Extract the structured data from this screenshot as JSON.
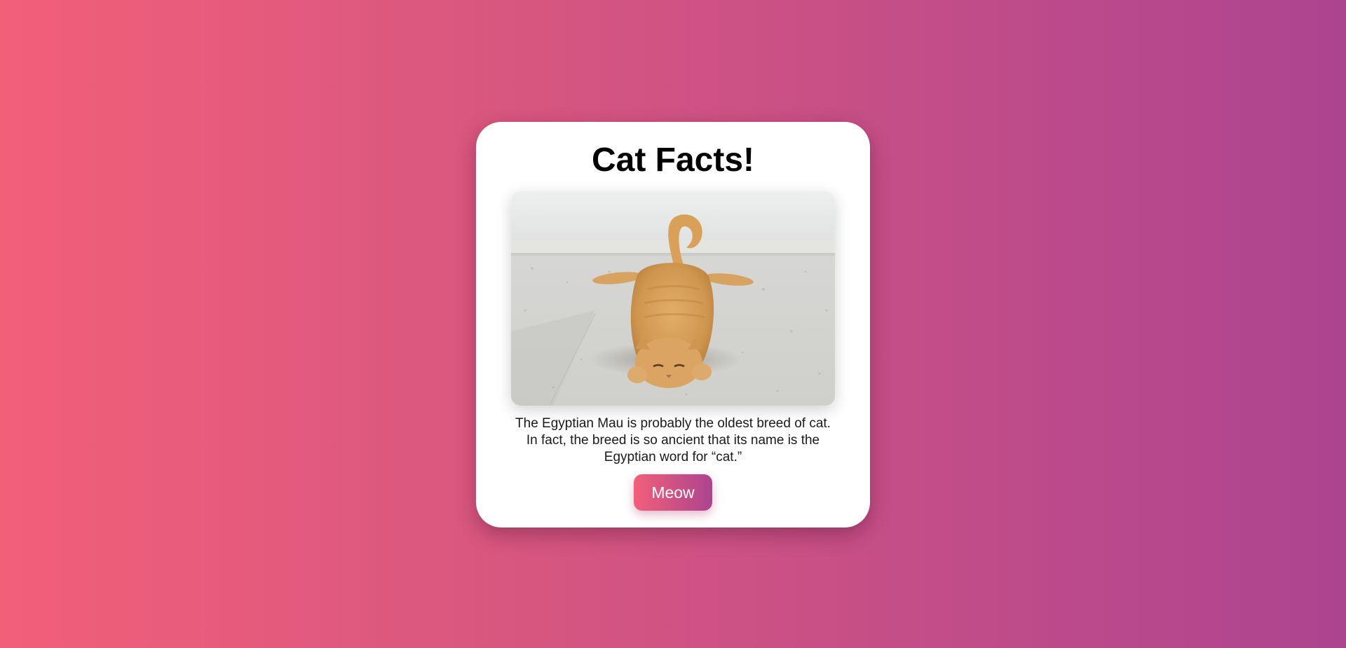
{
  "card": {
    "title": "Cat Facts!",
    "fact": "The Egyptian Mau is probably the oldest breed of cat. In fact, the breed is so ancient that its name is the Egyptian word for “cat.”",
    "button_label": "Meow"
  },
  "colors": {
    "background_start": "#f25f79",
    "background_end": "#ad4490",
    "card": "#ffffff",
    "button_start": "#f25f79",
    "button_end": "#ad4490"
  }
}
